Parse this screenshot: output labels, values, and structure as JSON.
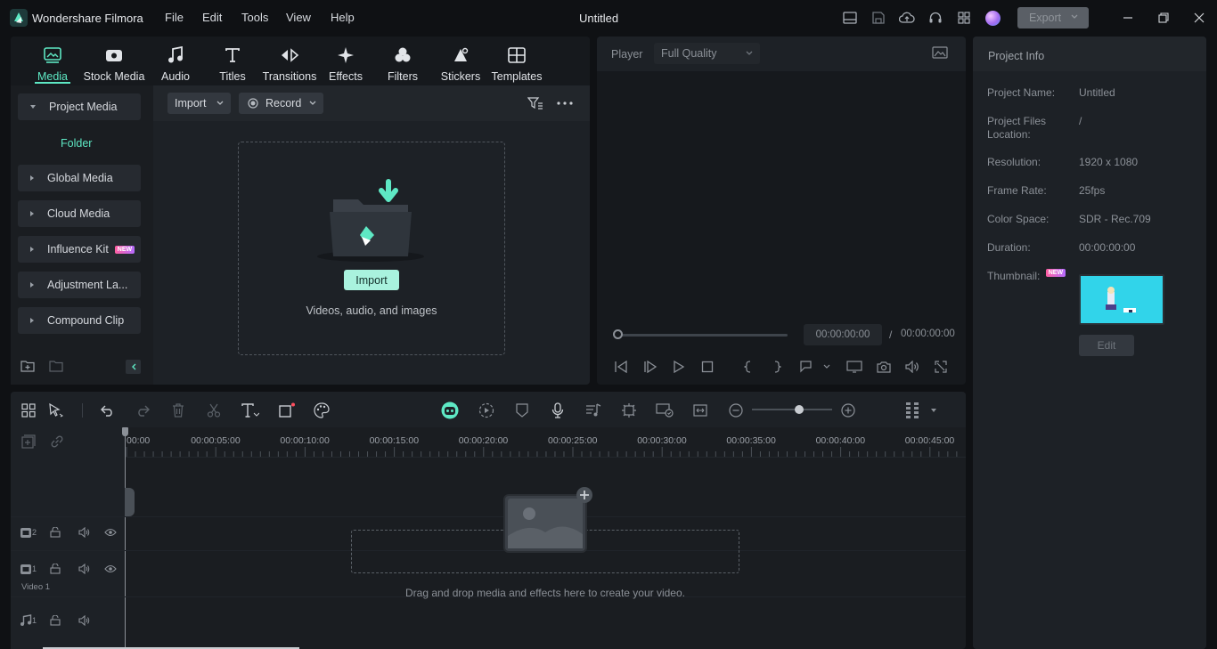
{
  "app": {
    "name": "Wondershare Filmora",
    "document_title": "Untitled",
    "menu": [
      "File",
      "Edit",
      "Tools",
      "View",
      "Help"
    ],
    "export_label": "Export"
  },
  "toolbar": {
    "tabs": [
      {
        "label": "Media",
        "icon": "media-icon",
        "active": true
      },
      {
        "label": "Stock Media",
        "icon": "stock-media-icon"
      },
      {
        "label": "Audio",
        "icon": "music-note-icon"
      },
      {
        "label": "Titles",
        "icon": "text-t-icon"
      },
      {
        "label": "Transitions",
        "icon": "transition-icon"
      },
      {
        "label": "Effects",
        "icon": "sparkle-icon"
      },
      {
        "label": "Filters",
        "icon": "filter-circles-icon"
      },
      {
        "label": "Stickers",
        "icon": "sticker-icon"
      },
      {
        "label": "Templates",
        "icon": "template-grid-icon"
      }
    ]
  },
  "sidebar": {
    "project_media": "Project Media",
    "folder": "Folder",
    "items": [
      "Global Media",
      "Cloud Media",
      "Influence Kit",
      "Adjustment La...",
      "Compound Clip"
    ],
    "new_badge": "NEW"
  },
  "media": {
    "import_dropdown": "Import",
    "record_dropdown": "Record",
    "import_button": "Import",
    "hint": "Videos, audio, and images"
  },
  "player": {
    "label": "Player",
    "quality": "Full Quality",
    "current_time": "00:00:00:00",
    "separator": "/",
    "total_time": "00:00:00:00"
  },
  "project_info": {
    "title": "Project Info",
    "rows": [
      {
        "label": "Project Name:",
        "value": "Untitled"
      },
      {
        "label": "Project Files Location:",
        "value": "/"
      },
      {
        "label": "Resolution:",
        "value": "1920 x 1080"
      },
      {
        "label": "Frame Rate:",
        "value": "25fps"
      },
      {
        "label": "Color Space:",
        "value": "SDR - Rec.709"
      },
      {
        "label": "Duration:",
        "value": "00:00:00:00"
      }
    ],
    "thumbnail_label": "Thumbnail:",
    "new_badge": "NEW",
    "edit_button": "Edit"
  },
  "timeline": {
    "ruler": [
      "00:00",
      "00:00:05:00",
      "00:00:10:00",
      "00:00:15:00",
      "00:00:20:00",
      "00:00:25:00",
      "00:00:30:00",
      "00:00:35:00",
      "00:00:40:00",
      "00:00:45:00"
    ],
    "drop_hint": "Drag and drop media and effects here to create your video.",
    "tracks": [
      {
        "number": "2",
        "type": "video"
      },
      {
        "number": "1",
        "type": "video",
        "name": "Video 1"
      },
      {
        "number": "1",
        "type": "audio"
      }
    ],
    "zoom_level": 0.5
  },
  "colors": {
    "accent": "#5ee8c4",
    "panel": "#1d2126",
    "background": "#0f1114"
  }
}
